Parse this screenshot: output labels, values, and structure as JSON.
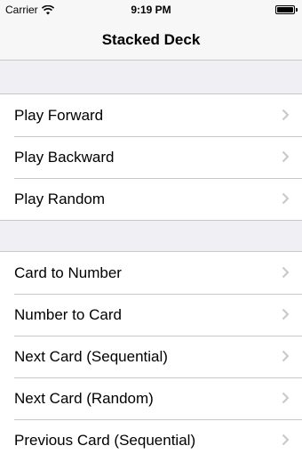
{
  "status_bar": {
    "carrier": "Carrier",
    "time": "9:19 PM",
    "wifi_icon": "wifi-icon",
    "battery_icon": "battery-icon",
    "battery_level": 1.0
  },
  "nav_bar": {
    "title": "Stacked Deck"
  },
  "sections": [
    {
      "items": [
        {
          "label": "Play Forward",
          "icon": "chevron-right-icon"
        },
        {
          "label": "Play Backward",
          "icon": "chevron-right-icon"
        },
        {
          "label": "Play Random",
          "icon": "chevron-right-icon"
        }
      ]
    },
    {
      "items": [
        {
          "label": "Card to Number",
          "icon": "chevron-right-icon"
        },
        {
          "label": "Number to Card",
          "icon": "chevron-right-icon"
        },
        {
          "label": "Next Card (Sequential)",
          "icon": "chevron-right-icon"
        },
        {
          "label": "Next Card (Random)",
          "icon": "chevron-right-icon"
        },
        {
          "label": "Previous Card (Sequential)",
          "icon": "chevron-right-icon"
        }
      ]
    }
  ],
  "colors": {
    "background": "#efeff4",
    "separator": "#c8c7cc",
    "chevron": "#c7c7cc"
  }
}
